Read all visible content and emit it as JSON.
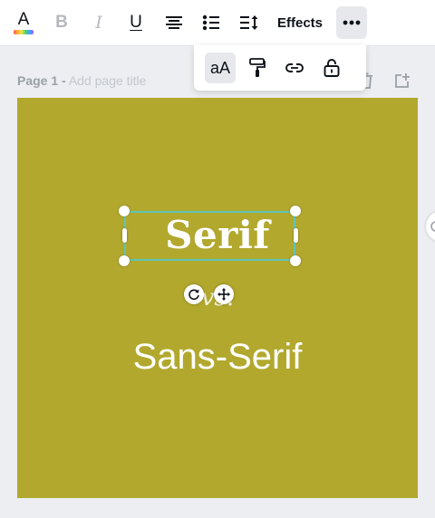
{
  "toolbar": {
    "text_color_glyph": "A",
    "bold_glyph": "B",
    "italic_glyph": "I",
    "underline_glyph": "U",
    "effects_label": "Effects"
  },
  "popover": {
    "case_label": "aA"
  },
  "page": {
    "number_label": "Page 1 -",
    "title_placeholder": "Add page title"
  },
  "canvas": {
    "background_color": "#b2a82e",
    "texts": {
      "serif": "Serif",
      "vs": "vs.",
      "sans": "Sans-Serif"
    }
  },
  "colors": {
    "selection": "#5ec4b6",
    "toolbar_bg": "#ffffff",
    "workspace_bg": "#eceef1"
  }
}
